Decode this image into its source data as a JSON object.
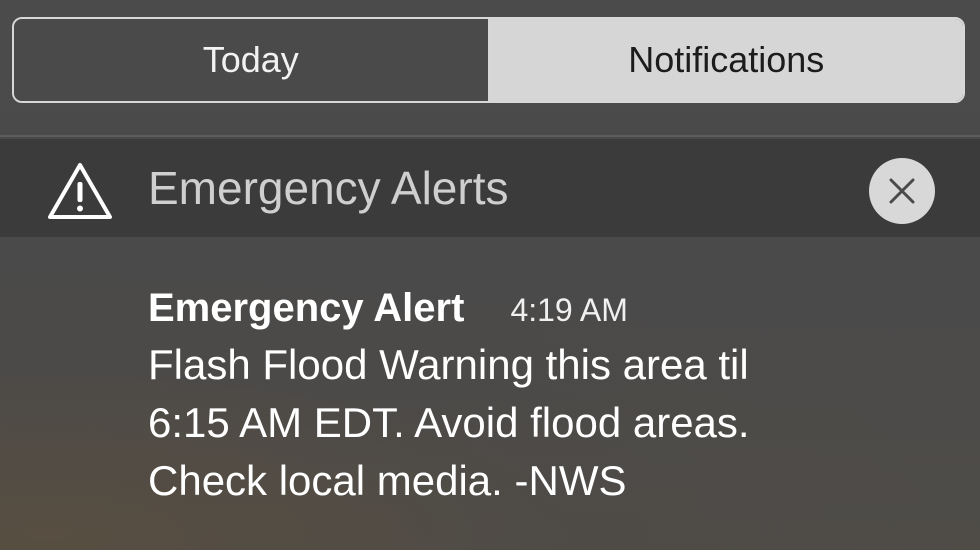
{
  "tabs": [
    {
      "label": "Today",
      "selected": false
    },
    {
      "label": "Notifications",
      "selected": true
    }
  ],
  "section": {
    "title": "Emergency Alerts",
    "icon": "warning-triangle-icon",
    "clear_icon": "close-icon"
  },
  "notification": {
    "title": "Emergency Alert",
    "time": "4:19 AM",
    "body_lines": [
      "Flash Flood Warning this area til",
      "6:15 AM EDT. Avoid flood areas.",
      "Check local media. -NWS"
    ]
  },
  "colors": {
    "background": "#4a4a4a",
    "header_band": "#3b3b3b",
    "selected_tab": "#d6d6d6",
    "text": "#ffffff"
  }
}
